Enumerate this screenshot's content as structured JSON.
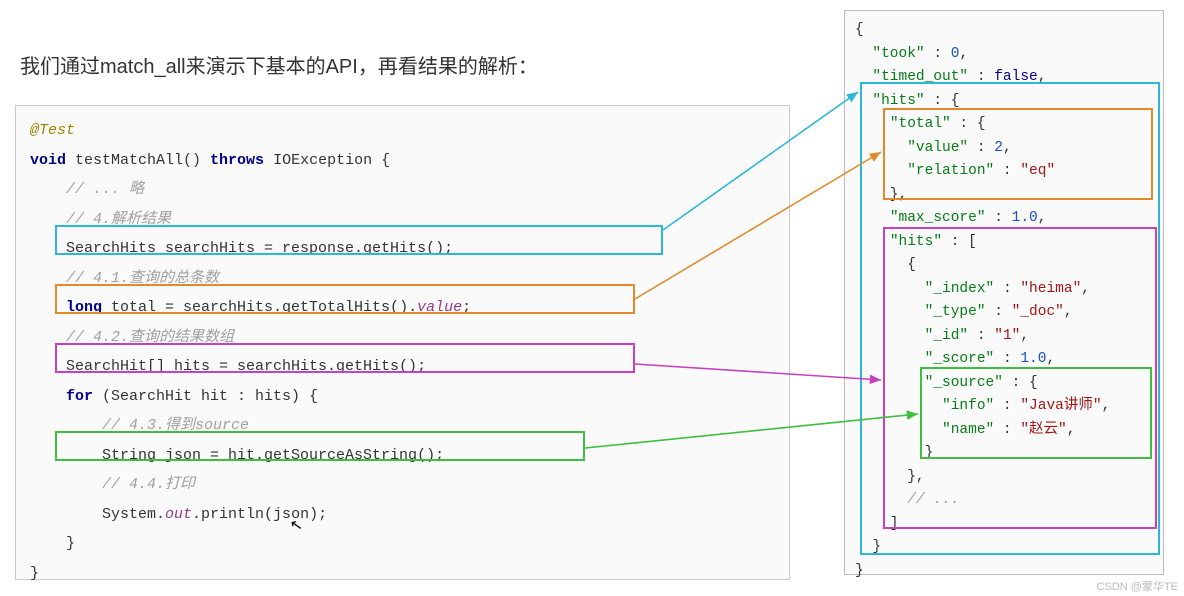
{
  "title": "我们通过match_all来演示下基本的API，再看结果的解析：",
  "code": {
    "ann": "@Test",
    "sig_void": "void",
    "sig_name": " testMatchAll() ",
    "sig_throws": "throws",
    "sig_ex": " IOException {",
    "c_skip": "    // ... 略",
    "c_parse": "    // 4.解析结果",
    "l_getHits": "    SearchHits searchHits = response.getHits();",
    "c_total": "    // 4.1.查询的总条数",
    "l_total_kw": "    long ",
    "l_total_mid": "total = searchHits.getTotalHits().",
    "l_total_val": "value",
    "l_total_end": ";",
    "c_arr": "    // 4.2.查询的结果数组",
    "l_hitsArr": "    SearchHit[] hits = searchHits.getHits();",
    "l_for_kw": "    for ",
    "l_for_rest": "(SearchHit hit : hits) {",
    "c_src": "        // 4.3.得到source",
    "l_src": "        String json = hit.getSourceAsString();",
    "c_print": "        // 4.4.打印",
    "l_print_a": "        System.",
    "l_print_out": "out",
    "l_print_b": ".println(json);",
    "close1": "    }",
    "close2": "}"
  },
  "json": {
    "open": "{",
    "took_k": "\"took\"",
    "took_v": "0",
    "to_k": "\"timed_out\"",
    "to_v": "false",
    "hits_k": "\"hits\"",
    "total_k": "\"total\"",
    "value_k": "\"value\"",
    "value_v": "2",
    "rel_k": "\"relation\"",
    "rel_v": "\"eq\"",
    "maxs_k": "\"max_score\"",
    "maxs_v": "1.0",
    "inhits_k": "\"hits\"",
    "idx_k": "\"_index\"",
    "idx_v": "\"heima\"",
    "type_k": "\"_type\"",
    "type_v": "\"_doc\"",
    "id_k": "\"_id\"",
    "id_v": "\"1\"",
    "score_k": "\"_score\"",
    "score_v": "1.0",
    "src_k": "\"_source\"",
    "info_k": "\"info\"",
    "info_v": "\"Java讲师\"",
    "name_k": "\"name\"",
    "name_v": "\"赵云\"",
    "dots": "// ..."
  },
  "watermark": "CSDN @蒙华TE"
}
